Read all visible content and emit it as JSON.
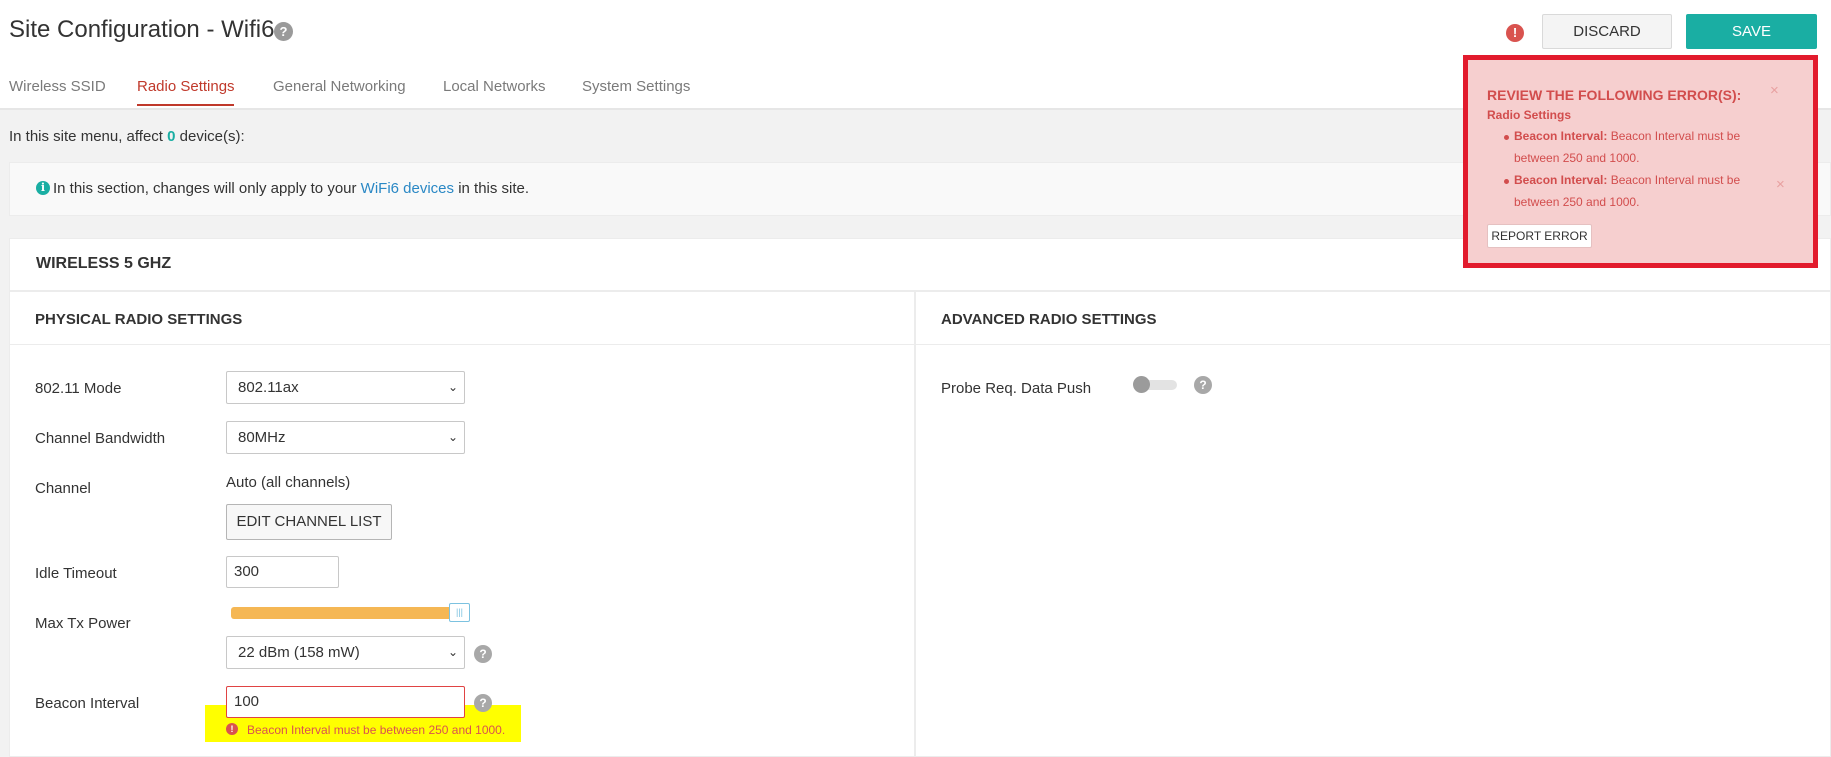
{
  "header": {
    "title": "Site Configuration - Wifi6",
    "help_glyph": "?",
    "error_glyph": "!",
    "discard_label": "DISCARD",
    "save_label": "SAVE"
  },
  "tabs": [
    {
      "label": "Wireless SSID",
      "active": false
    },
    {
      "label": "Radio Settings",
      "active": true
    },
    {
      "label": "General Networking",
      "active": false
    },
    {
      "label": "Local Networks",
      "active": false
    },
    {
      "label": "System Settings",
      "active": false
    }
  ],
  "affect": {
    "prefix": "In this site menu, affect ",
    "count": "0",
    "suffix": " device(s):"
  },
  "info": {
    "icon_glyph": "i",
    "prefix": "In this section, changes will only apply to your ",
    "link": "WiFi6 devices",
    "suffix": " in this site."
  },
  "card": {
    "title": "WIRELESS 5 GHZ",
    "physical_heading": "PHYSICAL RADIO SETTINGS",
    "advanced_heading": "ADVANCED RADIO SETTINGS"
  },
  "form": {
    "mode_label": "802.11 Mode",
    "mode_value": "802.11ax",
    "bandwidth_label": "Channel Bandwidth",
    "bandwidth_value": "80MHz",
    "channel_label": "Channel",
    "channel_value": "Auto (all channels)",
    "edit_channel_label": "EDIT CHANNEL LIST",
    "idle_label": "Idle Timeout",
    "idle_value": "300",
    "tx_label": "Max Tx Power",
    "tx_slider_level": 1.0,
    "tx_value": "22 dBm (158 mW)",
    "beacon_label": "Beacon Interval",
    "beacon_value": "100",
    "beacon_error": "Beacon Interval must be between 250 and 1000."
  },
  "advanced": {
    "probe_label": "Probe Req. Data Push",
    "probe_enabled": false
  },
  "error_popup": {
    "title": "REVIEW THE FOLLOWING ERROR(S):",
    "close_glyph": "×",
    "section": "Radio Settings",
    "items": [
      {
        "field": "Beacon Interval:",
        "line1": "Beacon Interval must be",
        "line2": "between 250 and 1000."
      },
      {
        "field": "Beacon Interval:",
        "line1": "Beacon Interval must be",
        "line2": "between 250 and 1000."
      }
    ],
    "report_label": "REPORT ERROR"
  },
  "colors": {
    "accent": "#1aaea3",
    "active_tab": "#c0392b",
    "error": "#d24d4d",
    "highlight": "#ffff00",
    "slider": "#f5b754"
  },
  "icons": [
    "help-icon",
    "error-icon",
    "info-icon",
    "chevron-down-icon",
    "close-icon",
    "slider-handle-icon"
  ]
}
